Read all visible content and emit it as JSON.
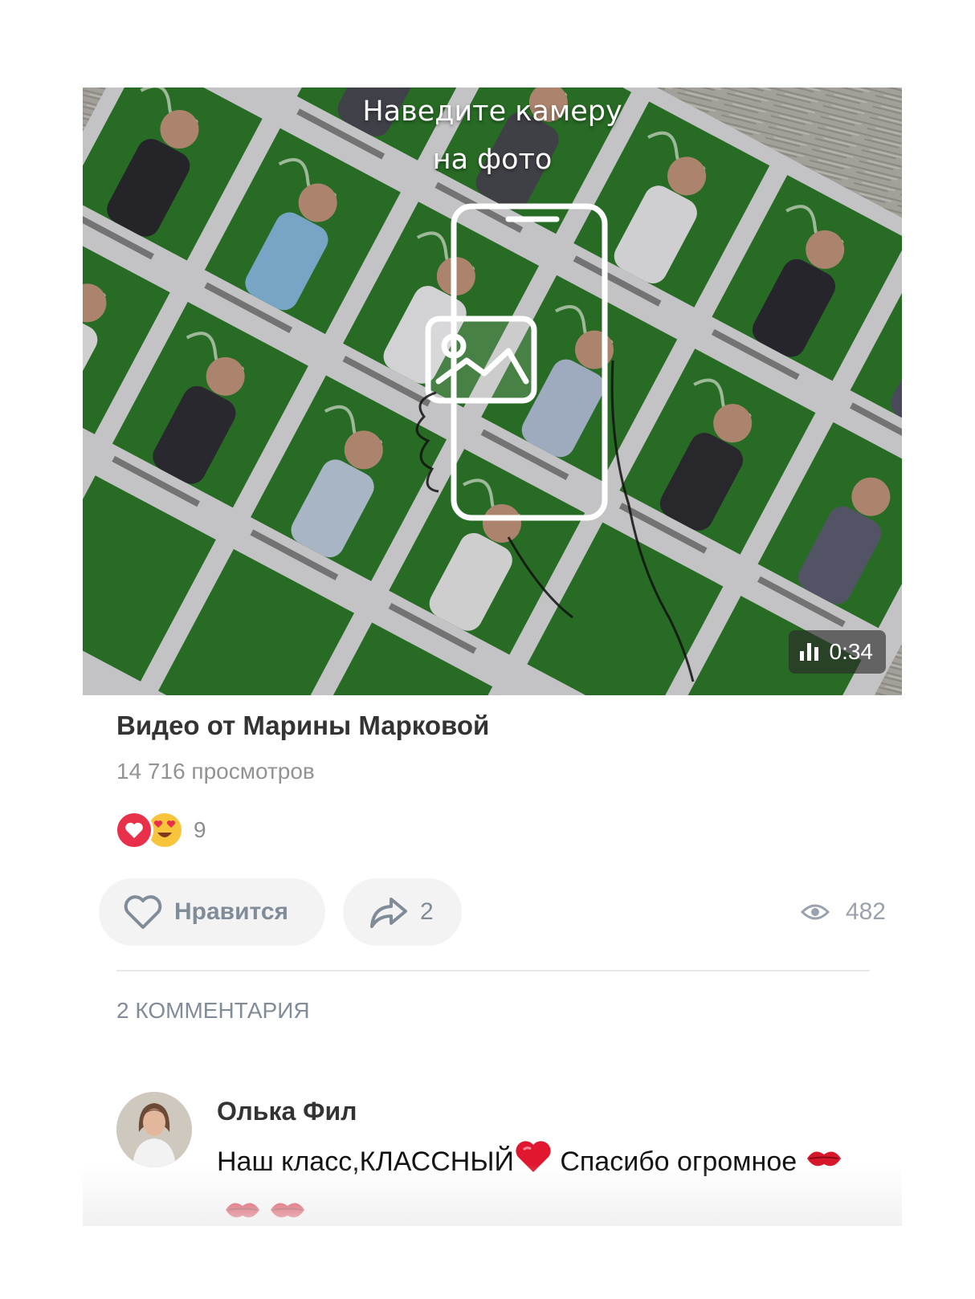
{
  "video": {
    "overlay_line1": "Наведите камеру",
    "overlay_line2": "на фото",
    "duration": "0:34",
    "poster_icon": "phone-with-photo-icon"
  },
  "post": {
    "title": "Видео от Марины Марковой",
    "views": "14 716 просмотров",
    "reactions": {
      "icons": [
        "heart-reaction-icon",
        "heart-eyes-reaction-icon"
      ],
      "count": "9"
    }
  },
  "actions": {
    "like_label": "Нравится",
    "share_count": "2",
    "seen_count": "482"
  },
  "comments": {
    "header": "2 КОММЕНТАРИЯ",
    "items": [
      {
        "author": "Олька Фил",
        "text_part1": "Наш класс,КЛАССНЫЙ",
        "text_part2": " Спасибо огромное ",
        "emojis": [
          "red-heart-emoji",
          "kiss-emoji",
          "kiss-emoji",
          "kiss-emoji"
        ]
      }
    ]
  },
  "colors": {
    "accent_gray": "#818c99",
    "pill_bg": "#f3f3f4",
    "reaction_red": "#e8304a",
    "reaction_yellow": "#f8c43b",
    "photo_green": "#2f7d2c"
  }
}
